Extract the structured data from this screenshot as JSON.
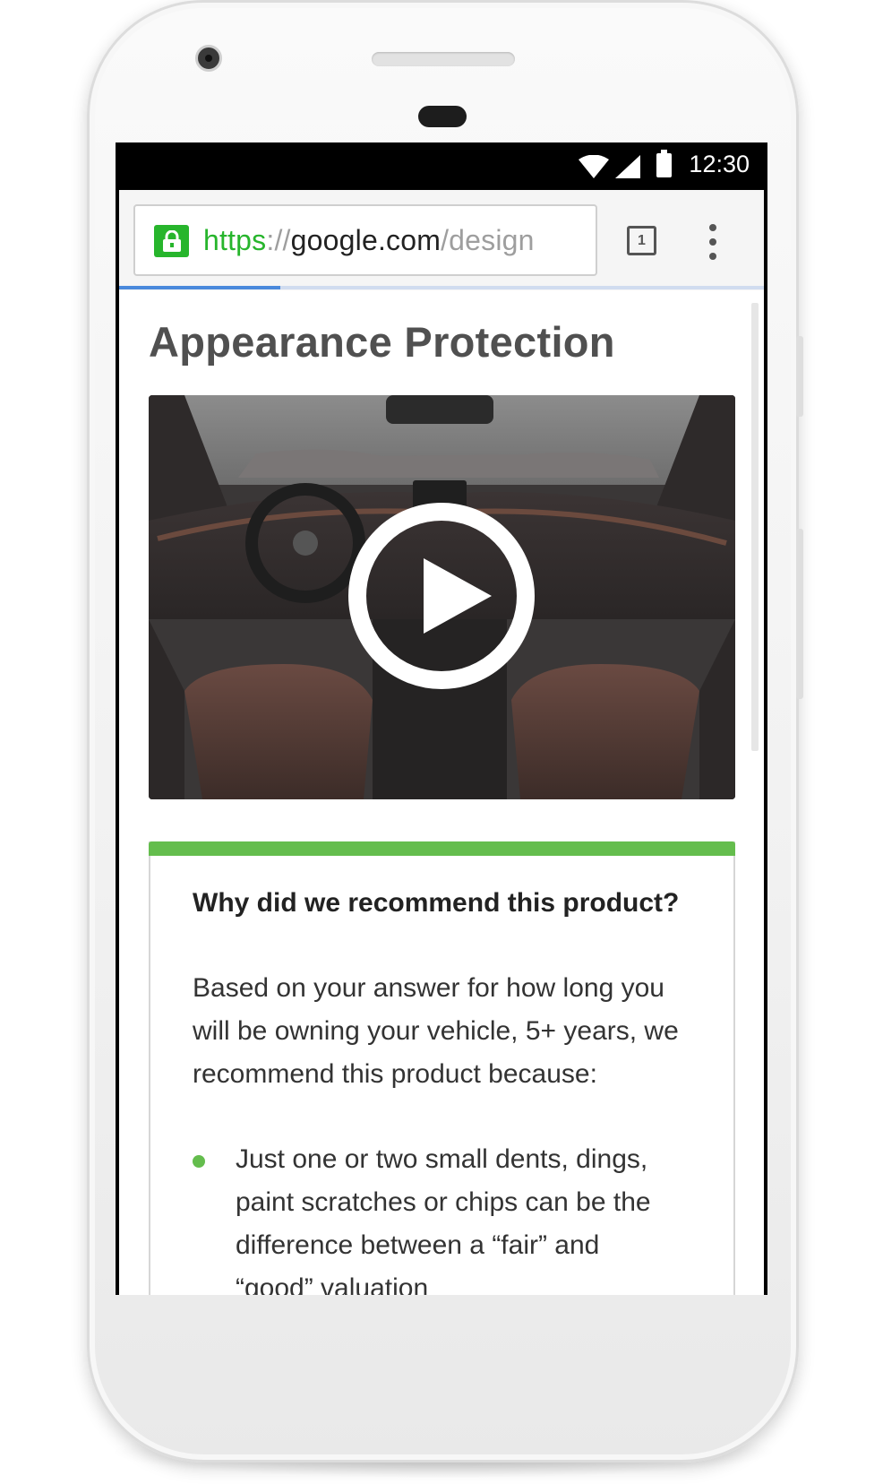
{
  "status_bar": {
    "time": "12:30"
  },
  "browser": {
    "url_scheme": "https",
    "url_separator": "://",
    "url_host": "google.com",
    "url_path": "/design",
    "tab_count": "1",
    "load_progress": 0.25
  },
  "page": {
    "title": "Appearance Protection",
    "video": {
      "description_icon": "play-icon"
    },
    "recommendation_card": {
      "heading": "Why did we recommend this product?",
      "body": "Based on your answer for how long you will be owning your vehicle, 5+ years, we recommend this product because:",
      "bullets": [
        "Just one or two small dents, dings, paint scratches or chips can be the difference between a “fair” and “good” valuation"
      ],
      "accent_color": "#64bd4d"
    }
  },
  "colors": {
    "secure_green": "#27b52c",
    "progress_blue": "#4a89dc"
  }
}
